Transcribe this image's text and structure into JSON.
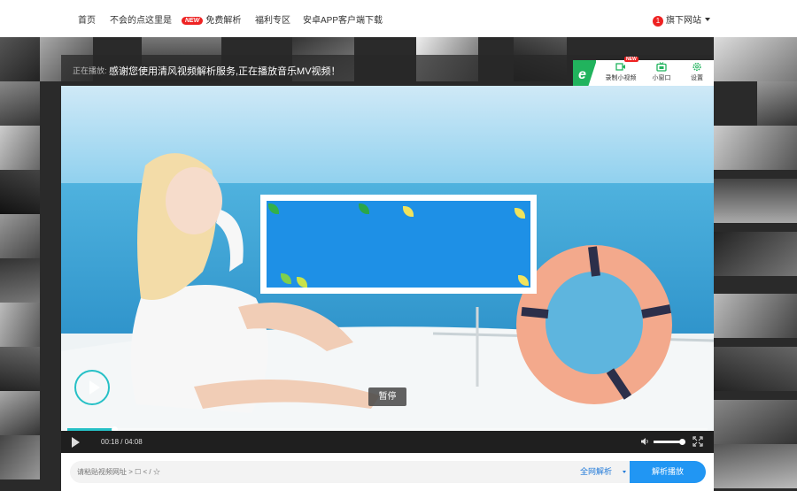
{
  "nav": {
    "items": [
      {
        "label": "首页"
      },
      {
        "label": "不会的点这里是"
      },
      {
        "badge": "NEW",
        "label": "免费解析"
      },
      {
        "label": "福利专区"
      },
      {
        "label": "安卓APP客户端下载"
      }
    ],
    "sites_count": "1",
    "sites_label": "旗下网站"
  },
  "player": {
    "now_label": "正在播放:",
    "now_text": "感谢您使用清风视频解析服务,正在播放音乐MV视频！",
    "tools": [
      {
        "label": "录制小视频",
        "badge": "NEW",
        "icon": "record-icon"
      },
      {
        "label": "小窗口",
        "icon": "tv-icon"
      },
      {
        "label": "设置",
        "icon": "gear-icon"
      }
    ],
    "pause_tip": "暂停",
    "time": "00:18 / 04:08",
    "progress": 0.073,
    "volume": 0.9,
    "colors": {
      "accent": "#26c0c6",
      "brand": "#21b35d"
    }
  },
  "search": {
    "placeholder": "请粘贴视频网址 > ☐ < / ☆",
    "select_value": "全网解析",
    "button_label": "解析播放",
    "button_color": "#2196f3"
  }
}
